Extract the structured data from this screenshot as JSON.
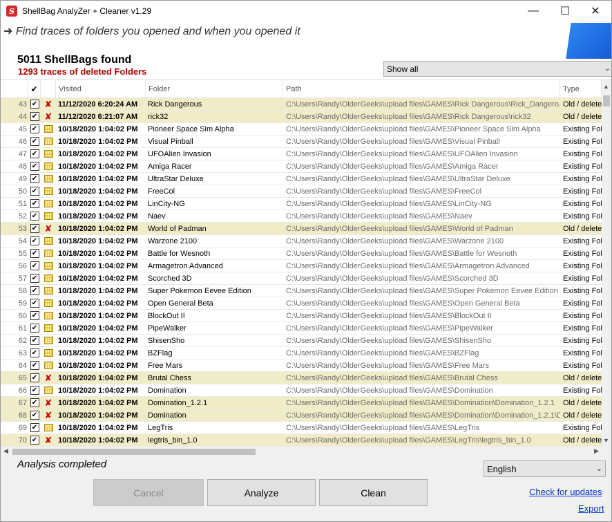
{
  "window": {
    "title": "ShellBag  AnalyZer + Cleaner v1.29",
    "icon_letter": "S",
    "controls": {
      "minimize": "—",
      "maximize": "☐",
      "close": "✕"
    }
  },
  "header": {
    "tagline": "➜ Find traces of folders you opened and when you opened it",
    "count_title": "5011 ShellBags found",
    "count_sub": "1293 traces of deleted Folders",
    "filter_value": "Show all"
  },
  "table": {
    "columns": {
      "check": "✔",
      "visited": "Visited",
      "folder": "Folder",
      "path": "Path",
      "type": "Type"
    },
    "rows": [
      {
        "num": "43",
        "deleted": true,
        "visited": "11/12/2020 6:20:24 AM",
        "folder": "Rick Dangerous",
        "path": "C:\\Users\\Randy\\OlderGeeks\\upload files\\GAMES\\Rick Dangerous\\Rick_Dangero...",
        "type": "Old / deleted"
      },
      {
        "num": "44",
        "deleted": true,
        "visited": "11/12/2020 6:21:07 AM",
        "folder": "rick32",
        "path": "C:\\Users\\Randy\\OlderGeeks\\upload files\\GAMES\\Rick Dangerous\\rick32",
        "type": "Old / deleted"
      },
      {
        "num": "45",
        "deleted": false,
        "visited": "10/18/2020 1:04:02 PM",
        "folder": "Pioneer Space Sim Alpha",
        "path": "C:\\Users\\Randy\\OlderGeeks\\upload files\\GAMES\\Pioneer Space Sim Alpha",
        "type": "Existing Folder"
      },
      {
        "num": "46",
        "deleted": false,
        "visited": "10/18/2020 1:04:02 PM",
        "folder": "Visual Pinball",
        "path": "C:\\Users\\Randy\\OlderGeeks\\upload files\\GAMES\\Visual Pinball",
        "type": "Existing Folder"
      },
      {
        "num": "47",
        "deleted": false,
        "visited": "10/18/2020 1:04:02 PM",
        "folder": "UFOAlien Invasion",
        "path": "C:\\Users\\Randy\\OlderGeeks\\upload files\\GAMES\\UFOAlien Invasion",
        "type": "Existing Folder"
      },
      {
        "num": "48",
        "deleted": false,
        "visited": "10/18/2020 1:04:02 PM",
        "folder": "Amiga Racer",
        "path": "C:\\Users\\Randy\\OlderGeeks\\upload files\\GAMES\\Amiga Racer",
        "type": "Existing Folder"
      },
      {
        "num": "49",
        "deleted": false,
        "visited": "10/18/2020 1:04:02 PM",
        "folder": "UltraStar Deluxe",
        "path": "C:\\Users\\Randy\\OlderGeeks\\upload files\\GAMES\\UltraStar Deluxe",
        "type": "Existing Folder"
      },
      {
        "num": "50",
        "deleted": false,
        "visited": "10/18/2020 1:04:02 PM",
        "folder": "FreeCol",
        "path": "C:\\Users\\Randy\\OlderGeeks\\upload files\\GAMES\\FreeCol",
        "type": "Existing Folder"
      },
      {
        "num": "51",
        "deleted": false,
        "visited": "10/18/2020 1:04:02 PM",
        "folder": "LinCity-NG",
        "path": "C:\\Users\\Randy\\OlderGeeks\\upload files\\GAMES\\LinCity-NG",
        "type": "Existing Folder"
      },
      {
        "num": "52",
        "deleted": false,
        "visited": "10/18/2020 1:04:02 PM",
        "folder": "Naev",
        "path": "C:\\Users\\Randy\\OlderGeeks\\upload files\\GAMES\\Naev",
        "type": "Existing Folder"
      },
      {
        "num": "53",
        "deleted": true,
        "visited": "10/18/2020 1:04:02 PM",
        "folder": "World of Padman",
        "path": "C:\\Users\\Randy\\OlderGeeks\\upload files\\GAMES\\World of Padman",
        "type": "Old / deleted"
      },
      {
        "num": "54",
        "deleted": false,
        "visited": "10/18/2020 1:04:02 PM",
        "folder": "Warzone 2100",
        "path": "C:\\Users\\Randy\\OlderGeeks\\upload files\\GAMES\\Warzone 2100",
        "type": "Existing Folder"
      },
      {
        "num": "55",
        "deleted": false,
        "visited": "10/18/2020 1:04:02 PM",
        "folder": "Battle for Wesnoth",
        "path": "C:\\Users\\Randy\\OlderGeeks\\upload files\\GAMES\\Battle for Wesnoth",
        "type": "Existing Folder"
      },
      {
        "num": "56",
        "deleted": false,
        "visited": "10/18/2020 1:04:02 PM",
        "folder": "Armagetron Advanced",
        "path": "C:\\Users\\Randy\\OlderGeeks\\upload files\\GAMES\\Armagetron Advanced",
        "type": "Existing Folder"
      },
      {
        "num": "57",
        "deleted": false,
        "visited": "10/18/2020 1:04:02 PM",
        "folder": "Scorched 3D",
        "path": "C:\\Users\\Randy\\OlderGeeks\\upload files\\GAMES\\Scorched 3D",
        "type": "Existing Folder"
      },
      {
        "num": "58",
        "deleted": false,
        "visited": "10/18/2020 1:04:02 PM",
        "folder": "Super Pokemon Eevee Edition",
        "path": "C:\\Users\\Randy\\OlderGeeks\\upload files\\GAMES\\Super Pokemon Eevee Edition",
        "type": "Existing Folder"
      },
      {
        "num": "59",
        "deleted": false,
        "visited": "10/18/2020 1:04:02 PM",
        "folder": "Open General Beta",
        "path": "C:\\Users\\Randy\\OlderGeeks\\upload files\\GAMES\\Open General Beta",
        "type": "Existing Folder"
      },
      {
        "num": "60",
        "deleted": false,
        "visited": "10/18/2020 1:04:02 PM",
        "folder": "BlockOut II",
        "path": "C:\\Users\\Randy\\OlderGeeks\\upload files\\GAMES\\BlockOut II",
        "type": "Existing Folder"
      },
      {
        "num": "61",
        "deleted": false,
        "visited": "10/18/2020 1:04:02 PM",
        "folder": "PipeWalker",
        "path": "C:\\Users\\Randy\\OlderGeeks\\upload files\\GAMES\\PipeWalker",
        "type": "Existing Folder"
      },
      {
        "num": "62",
        "deleted": false,
        "visited": "10/18/2020 1:04:02 PM",
        "folder": "ShisenSho",
        "path": "C:\\Users\\Randy\\OlderGeeks\\upload files\\GAMES\\ShisenSho",
        "type": "Existing Folder"
      },
      {
        "num": "63",
        "deleted": false,
        "visited": "10/18/2020 1:04:02 PM",
        "folder": "BZFlag",
        "path": "C:\\Users\\Randy\\OlderGeeks\\upload files\\GAMES\\BZFlag",
        "type": "Existing Folder"
      },
      {
        "num": "64",
        "deleted": false,
        "visited": "10/18/2020 1:04:02 PM",
        "folder": "Free Mars",
        "path": "C:\\Users\\Randy\\OlderGeeks\\upload files\\GAMES\\Free Mars",
        "type": "Existing Folder"
      },
      {
        "num": "65",
        "deleted": true,
        "visited": "10/18/2020 1:04:02 PM",
        "folder": "Brutal Chess",
        "path": "C:\\Users\\Randy\\OlderGeeks\\upload files\\GAMES\\Brutal Chess",
        "type": "Old / deleted"
      },
      {
        "num": "66",
        "deleted": false,
        "visited": "10/18/2020 1:04:02 PM",
        "folder": "Domination",
        "path": "C:\\Users\\Randy\\OlderGeeks\\upload files\\GAMES\\Domination",
        "type": "Existing Folder"
      },
      {
        "num": "67",
        "deleted": true,
        "visited": "10/18/2020 1:04:02 PM",
        "folder": "Domination_1.2.1",
        "path": "C:\\Users\\Randy\\OlderGeeks\\upload files\\GAMES\\Domination\\Domination_1.2.1",
        "type": "Old / deleted"
      },
      {
        "num": "68",
        "deleted": true,
        "visited": "10/18/2020 1:04:02 PM",
        "folder": "Domination",
        "path": "C:\\Users\\Randy\\OlderGeeks\\upload files\\GAMES\\Domination\\Domination_1.2.1\\D...",
        "type": "Old / deleted"
      },
      {
        "num": "69",
        "deleted": false,
        "visited": "10/18/2020 1:04:02 PM",
        "folder": "LegTris",
        "path": "C:\\Users\\Randy\\OlderGeeks\\upload files\\GAMES\\LegTris",
        "type": "Existing Folder"
      },
      {
        "num": "70",
        "deleted": true,
        "visited": "10/18/2020 1:04:02 PM",
        "folder": "legtris_bin_1.0",
        "path": "C:\\Users\\Randy\\OlderGeeks\\upload files\\GAMES\\LegTris\\legtris_bin_1.0",
        "type": "Old / deleted"
      }
    ]
  },
  "footer": {
    "status": "Analysis completed",
    "language": "English",
    "cancel_label": "Cancel",
    "analyze_label": "Analyze",
    "clean_label": "Clean",
    "updates_link": "Check for updates",
    "export_link": "Export"
  },
  "colors": {
    "deleted_row": "#f1ecc8",
    "deleted_count": "#b00000",
    "delete_icon": "#d00000",
    "link": "#0033cc",
    "brand_blue": "#2e86f0"
  },
  "icons": {
    "deleted": "red-x-icon",
    "existing": "folder-grid-icon"
  }
}
